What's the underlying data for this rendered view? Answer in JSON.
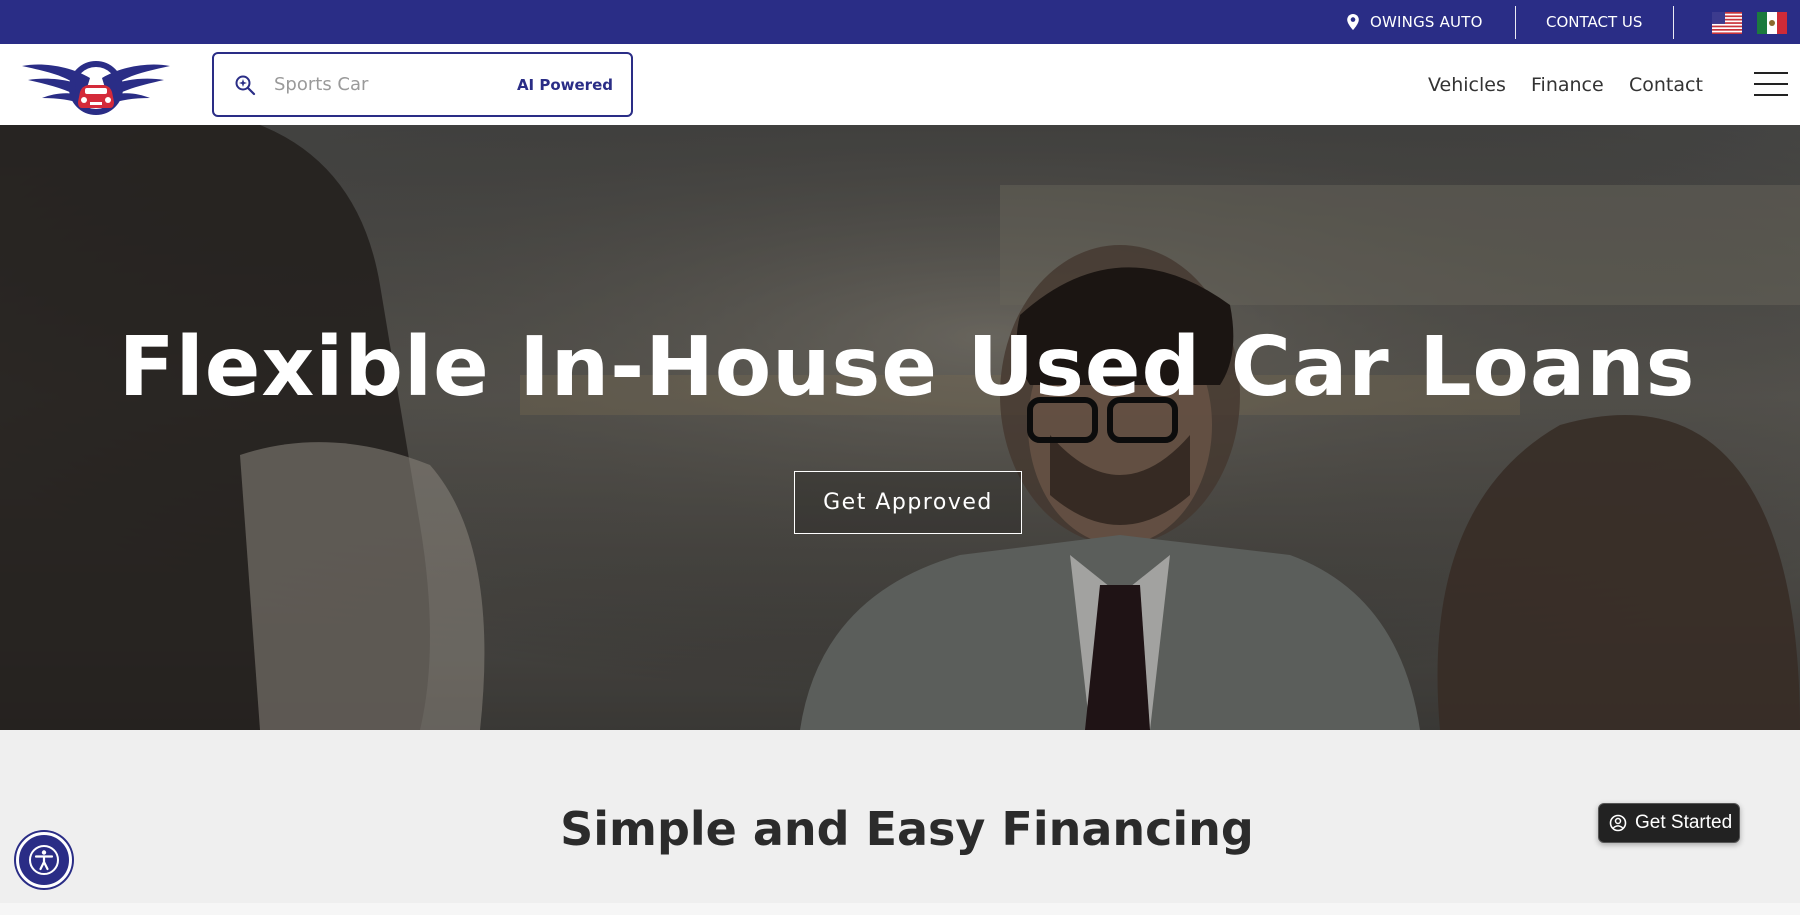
{
  "topbar": {
    "location_label": "OWINGS AUTO",
    "contact_label": "CONTACT US",
    "languages": [
      "en-us-flag-icon",
      "es-mx-flag-icon"
    ]
  },
  "header": {
    "search": {
      "placeholder": "Sports Car",
      "badge": "AI Powered"
    },
    "nav": [
      "Vehicles",
      "Finance",
      "Contact"
    ]
  },
  "hero": {
    "title": "Flexible In-House Used Car Loans",
    "cta_label": "Get Approved"
  },
  "section": {
    "title": "Simple and Easy Financing"
  },
  "widgets": {
    "get_started_label": "Get Started",
    "accessibility_icon": "accessibility-icon"
  },
  "colors": {
    "brand_navy": "#2a2d86",
    "logo_red": "#d42a3a",
    "text_dark": "#2b2b2b",
    "section_bg": "#efefef"
  }
}
